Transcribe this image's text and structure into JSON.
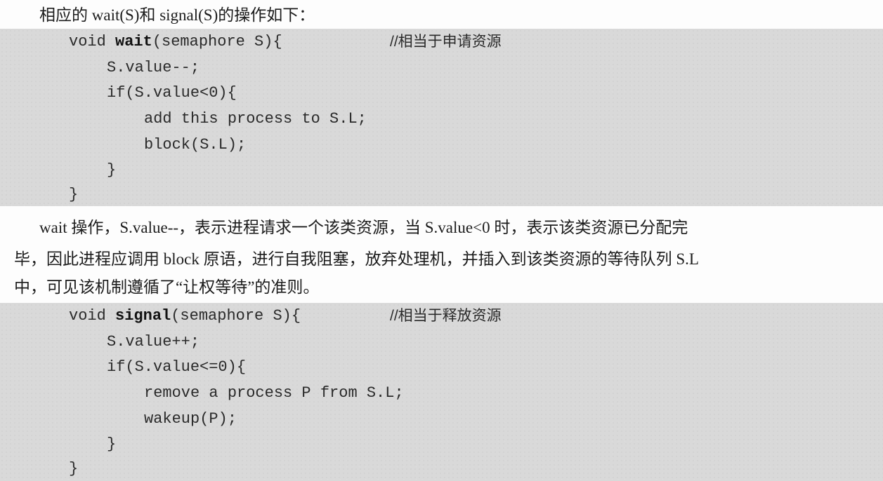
{
  "intro": "相应的 wait(S)和 signal(S)的操作如下：",
  "wait_block": {
    "sig_prefix": "void ",
    "func_name": "wait",
    "sig_suffix": "(semaphore S){",
    "comment": "//相当于申请资源",
    "lines": [
      "S.value--;",
      "if(S.value<0){",
      "add this process to S.L;",
      "block(S.L);",
      "}",
      "}"
    ]
  },
  "paragraph": {
    "line1": "wait 操作，S.value--，表示进程请求一个该类资源，当 S.value<0 时，表示该类资源已分配完",
    "line2": "毕，因此进程应调用 block 原语，进行自我阻塞，放弃处理机，并插入到该类资源的等待队列 S.L",
    "line3": "中，可见该机制遵循了“让权等待”的准则。"
  },
  "signal_block": {
    "sig_prefix": "void ",
    "func_name": "signal",
    "sig_suffix": "(semaphore S){",
    "comment": "//相当于释放资源",
    "lines": [
      "S.value++;",
      "if(S.value<=0){",
      "remove a process P from S.L;",
      "wakeup(P);",
      "}",
      "}"
    ]
  }
}
